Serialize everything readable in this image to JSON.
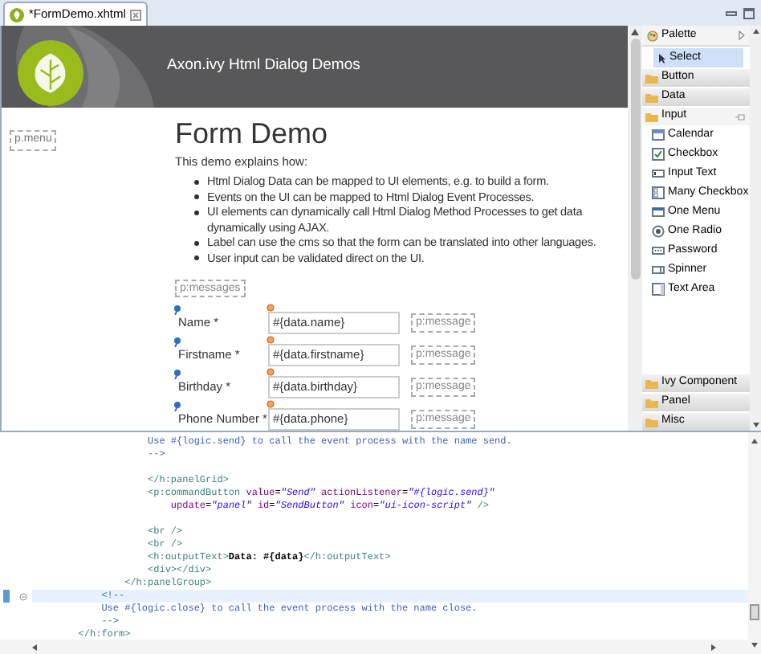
{
  "editor_tab": {
    "title": "*FormDemo.xhtml",
    "selected": true
  },
  "design": {
    "header_title": "Axon.ivy Html Dialog Demos",
    "menu_placeholder": "p.menu",
    "heading": "Form Demo",
    "intro": "This demo explains how:",
    "bullets": [
      "Html Dialog Data can be mapped to UI elements, e.g. to build a form.",
      "Events on the UI can be mapped to Html Dialog Event Processes.",
      "UI elements can dynamically call Html Dialog Method Processes to get data dynamically using AJAX.",
      "Label can use the cms so that the form can be translated into other languages.",
      "User input can be validated direct on the UI."
    ],
    "messages_placeholder": "p:messages",
    "fields": [
      {
        "label": "Name *",
        "value": "#{data.name}",
        "message": "p:message"
      },
      {
        "label": "Firstname *",
        "value": "#{data.firstname}",
        "message": "p:message"
      },
      {
        "label": "Birthday *",
        "value": "#{data.birthday}",
        "message": "p:message"
      },
      {
        "label": "Phone Number *",
        "value": "#{data.phone}",
        "message": "p:message"
      }
    ]
  },
  "palette": {
    "title": "Palette",
    "tools": [
      {
        "label": "Select",
        "selected": true
      }
    ],
    "drawers": [
      {
        "label": "Button",
        "expanded": false
      },
      {
        "label": "Data",
        "expanded": false
      },
      {
        "label": "Input",
        "expanded": true,
        "items": [
          {
            "label": "Calendar",
            "kind": "calendar"
          },
          {
            "label": "Checkbox",
            "kind": "checkbox"
          },
          {
            "label": "Input Text",
            "kind": "inputtext"
          },
          {
            "label": "Many Checkbox",
            "kind": "manycheckbox"
          },
          {
            "label": "One Menu",
            "kind": "onemenu"
          },
          {
            "label": "One Radio",
            "kind": "oneradio"
          },
          {
            "label": "Password",
            "kind": "password"
          },
          {
            "label": "Spinner",
            "kind": "spinner"
          },
          {
            "label": "Text Area",
            "kind": "textarea"
          }
        ]
      },
      {
        "label": "Ivy Component",
        "expanded": false
      },
      {
        "label": "Panel",
        "expanded": false
      },
      {
        "label": "Misc",
        "expanded": false
      }
    ]
  },
  "code": [
    {
      "current": false,
      "blank_before": false,
      "segments": [
        {
          "kind": "comment",
          "text": "                    Use #{logic.send} to call the event process with the name send."
        }
      ]
    },
    {
      "current": false,
      "blank_before": false,
      "segments": [
        {
          "kind": "comment",
          "text": "                    -->"
        }
      ]
    },
    {
      "current": false,
      "blank_before": true,
      "segments": [
        {
          "kind": "tag",
          "text": "                    </h:panelGrid>"
        }
      ]
    },
    {
      "current": false,
      "blank_before": false,
      "segments": [
        {
          "kind": "tag",
          "text": "                    <p:commandButton"
        },
        {
          "kind": "attr",
          "text": " value"
        },
        {
          "kind": "text",
          "text": "="
        },
        {
          "kind": "string",
          "text": "\"Send\""
        },
        {
          "kind": "attr",
          "text": " actionListener"
        },
        {
          "kind": "text",
          "text": "="
        },
        {
          "kind": "string",
          "text": "\"#{logic.send}\""
        }
      ]
    },
    {
      "current": false,
      "blank_before": false,
      "segments": [
        {
          "kind": "attr",
          "text": "                        update"
        },
        {
          "kind": "text",
          "text": "="
        },
        {
          "kind": "string",
          "text": "\"panel\""
        },
        {
          "kind": "attr",
          "text": " id"
        },
        {
          "kind": "text",
          "text": "="
        },
        {
          "kind": "string",
          "text": "\"SendButton\""
        },
        {
          "kind": "attr",
          "text": " icon"
        },
        {
          "kind": "text",
          "text": "="
        },
        {
          "kind": "string",
          "text": "\"ui-icon-script\""
        },
        {
          "kind": "tag",
          "text": " />"
        }
      ]
    },
    {
      "current": false,
      "blank_before": true,
      "segments": [
        {
          "kind": "tag",
          "text": "                    <br />"
        }
      ]
    },
    {
      "current": false,
      "blank_before": false,
      "segments": [
        {
          "kind": "tag",
          "text": "                    <br />"
        }
      ]
    },
    {
      "current": false,
      "blank_before": false,
      "segments": [
        {
          "kind": "tag",
          "text": "                    <h:outputText>"
        },
        {
          "kind": "content",
          "text": "Data: #{data}"
        },
        {
          "kind": "tag",
          "text": "</h:outputText>"
        }
      ]
    },
    {
      "current": false,
      "blank_before": false,
      "segments": [
        {
          "kind": "tag",
          "text": "                    <div></div>"
        }
      ]
    },
    {
      "current": false,
      "blank_before": false,
      "segments": [
        {
          "kind": "tag",
          "text": "                </h:panelGroup>"
        }
      ]
    },
    {
      "current": true,
      "blank_before": false,
      "segments": [
        {
          "kind": "comment",
          "text": "            <!--"
        }
      ]
    },
    {
      "current": false,
      "blank_before": false,
      "segments": [
        {
          "kind": "comment",
          "text": "            Use #{logic.close} to call the event process with the name close."
        }
      ]
    },
    {
      "current": false,
      "blank_before": false,
      "segments": [
        {
          "kind": "comment",
          "text": "            -->"
        }
      ]
    },
    {
      "current": false,
      "blank_before": false,
      "segments": [
        {
          "kind": "tag",
          "text": "        </h:form>"
        }
      ]
    }
  ]
}
